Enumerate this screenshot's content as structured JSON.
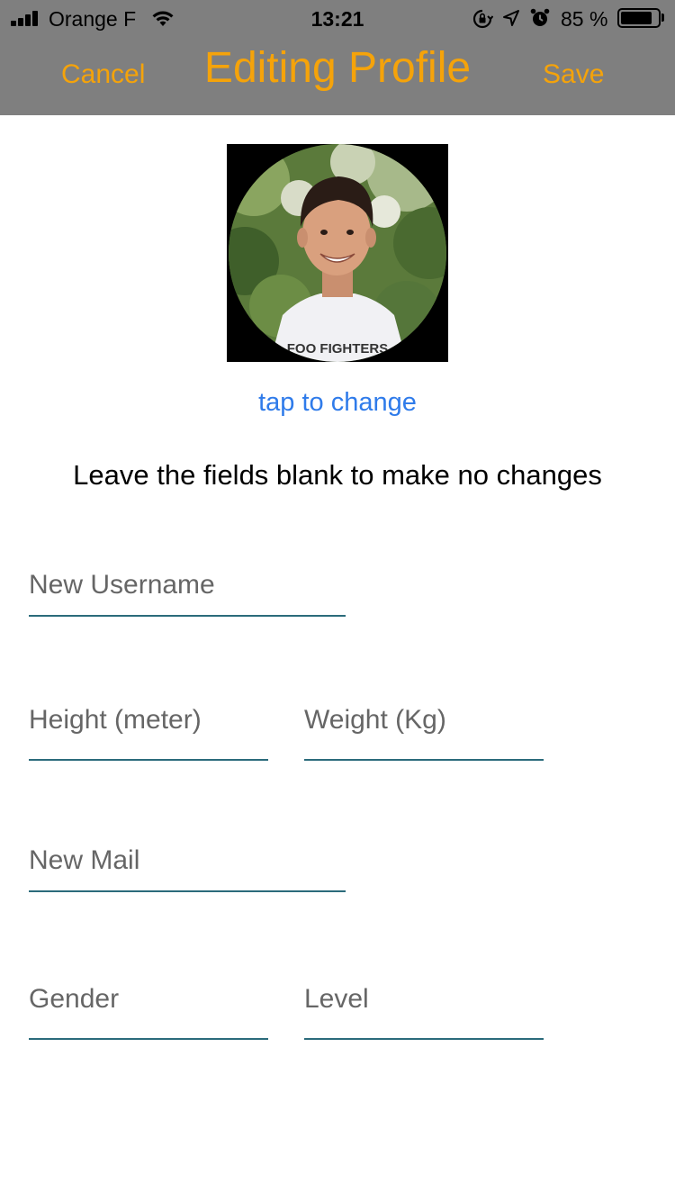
{
  "status_bar": {
    "carrier": "Orange F",
    "time": "13:21",
    "battery_percent": "85 %",
    "battery_level": 0.85,
    "icons": [
      "signal-icon",
      "wifi-icon",
      "rotation-lock-icon",
      "location-arrow-icon",
      "alarm-icon",
      "battery-icon"
    ]
  },
  "nav": {
    "cancel_label": "Cancel",
    "title": "Editing Profile",
    "save_label": "Save"
  },
  "avatar": {
    "shirt_text": "FOO FIGHTERS",
    "change_label": "tap to change"
  },
  "instructions": "Leave the fields blank to make no changes",
  "form": {
    "username_placeholder": "New Username",
    "height_placeholder": "Height (meter)",
    "weight_placeholder": "Weight (Kg)",
    "mail_placeholder": "New Mail",
    "gender_placeholder": "Gender",
    "level_placeholder": "Level"
  },
  "colors": {
    "header_bg": "#7f7f7f",
    "accent_orange": "#f5a30a",
    "link_blue": "#2f7bea",
    "field_underline": "#2b6b7b"
  }
}
